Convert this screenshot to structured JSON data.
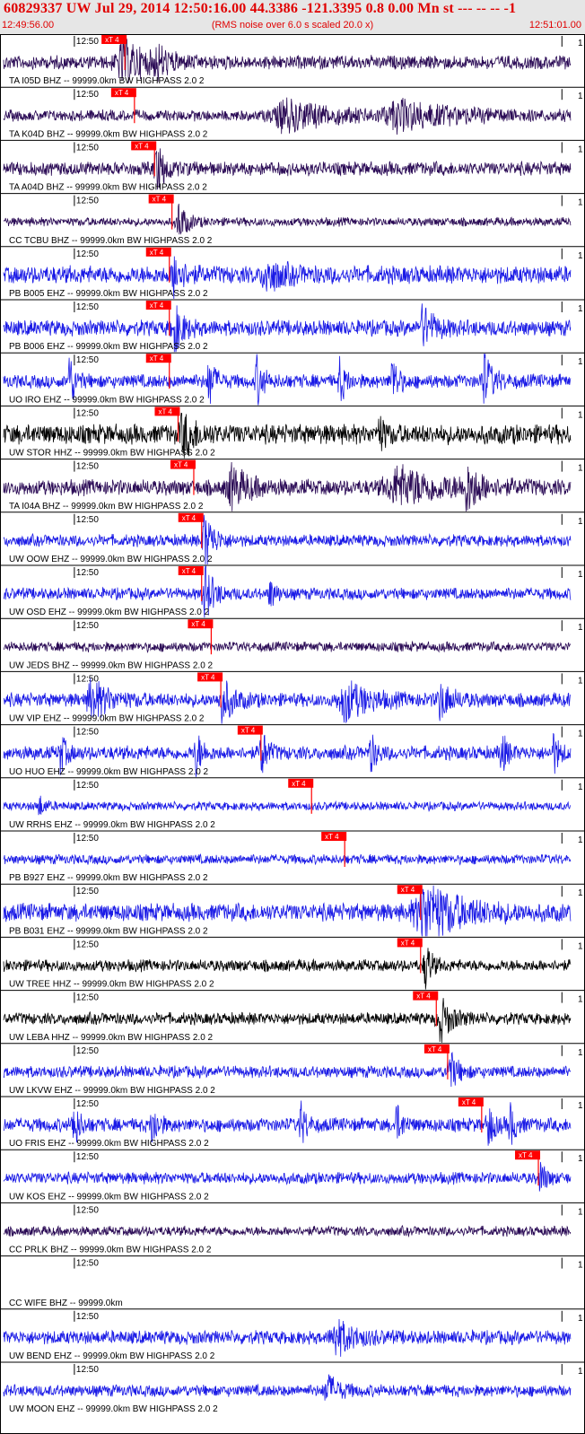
{
  "header": {
    "title": "60829337 UW Jul 29, 2014 12:50:16.00    44.3386 -121.3395  0.8 0.00 Mn st --- -- --   -1",
    "start_time": "12:49:56.00",
    "subtitle": "(RMS noise over 6.0 s scaled 20.0 x)",
    "end_time": "12:51:01.00"
  },
  "chart_data": {
    "type": "line",
    "title": "60829337 UW Jul 29, 2014 12:50:16.00    44.3386 -121.3395  0.8 0.00 Mn st --- -- --   -1",
    "x_range": [
      "12:49:56.00",
      "12:51:01.00"
    ],
    "x_range_seconds": [
      0,
      65
    ],
    "tick_label": "12:50",
    "tick_seconds": [
      4,
      64
    ],
    "pick_label": "xT 4",
    "traces": [
      {
        "label": "TA I05D BHZ -- 99999.0km BW  HIGHPASS  2.0  2",
        "color": "#2a0a55",
        "pick_s": 13.9,
        "amp": 0.35,
        "bursts": [
          [
            13.5,
            4,
            1.0
          ],
          [
            17.5,
            2,
            0.6
          ]
        ]
      },
      {
        "label": "TA K04D BHZ -- 99999.0km BW  HIGHPASS  2.0  2",
        "color": "#2a0a55",
        "pick_s": 15.0,
        "amp": 0.28,
        "bursts": [
          [
            32,
            8,
            0.7
          ],
          [
            45,
            10,
            0.6
          ]
        ]
      },
      {
        "label": "TA A04D BHZ -- 99999.0km BW  HIGHPASS  2.0  2",
        "color": "#2a0a55",
        "pick_s": 17.3,
        "amp": 0.35,
        "bursts": [
          [
            17.5,
            1.5,
            1.1
          ]
        ]
      },
      {
        "label": "CC TCBU BHZ -- 99999.0km BW  HIGHPASS  2.0  2",
        "color": "#2a0a55",
        "pick_s": 19.3,
        "amp": 0.22,
        "bursts": [
          [
            20,
            1.5,
            0.9
          ]
        ]
      },
      {
        "label": "PB B005 EHZ -- 99999.0km BW  HIGHPASS  2.0  2",
        "color": "#1a1ae6",
        "pick_s": 19.0,
        "amp": 0.45,
        "bursts": [
          [
            19.5,
            1.5,
            1.0
          ],
          [
            30,
            3,
            0.7
          ]
        ]
      },
      {
        "label": "PB B006 EHZ -- 99999.0km BW  HIGHPASS  2.0  2",
        "color": "#1a1ae6",
        "pick_s": 19.0,
        "amp": 0.4,
        "bursts": [
          [
            19.5,
            1.5,
            1.1
          ],
          [
            48,
            2,
            0.9
          ]
        ]
      },
      {
        "label": "UO IRO EHZ -- 99999.0km BW  HIGHPASS  2.0  2",
        "color": "#1a1ae6",
        "pick_s": 19.0,
        "amp": 0.35,
        "bursts": [
          [
            7.5,
            1,
            1.3
          ],
          [
            23.5,
            1,
            1.2
          ],
          [
            29,
            1,
            1.3
          ],
          [
            38.5,
            1,
            1.0
          ],
          [
            44.5,
            1,
            1.2
          ],
          [
            55,
            1.5,
            1.3
          ]
        ]
      },
      {
        "label": "UW STOR HHZ -- 99999.0km BW  HIGHPASS  2.0  2",
        "color": "#000000",
        "pick_s": 20.0,
        "amp": 0.5,
        "bursts": [
          [
            20.5,
            2,
            1.0
          ],
          [
            43,
            1,
            0.8
          ]
        ]
      },
      {
        "label": "TA I04A BHZ -- 99999.0km BW  HIGHPASS  2.0  2",
        "color": "#2a0a55",
        "pick_s": 21.8,
        "amp": 0.4,
        "bursts": [
          [
            26,
            3,
            0.9
          ],
          [
            45,
            8,
            0.8
          ],
          [
            53,
            2,
            1.0
          ]
        ]
      },
      {
        "label": "UW OOW EHZ -- 99999.0km BW  HIGHPASS  2.0  2",
        "color": "#1a1ae6",
        "pick_s": 22.7,
        "amp": 0.3,
        "bursts": [
          [
            23,
            1.5,
            1.4
          ]
        ]
      },
      {
        "label": "UW OSD EHZ -- 99999.0km BW  HIGHPASS  2.0  2",
        "color": "#1a1ae6",
        "pick_s": 22.7,
        "amp": 0.3,
        "bursts": [
          [
            23,
            1.5,
            1.4
          ],
          [
            30.5,
            1,
            0.7
          ]
        ]
      },
      {
        "label": "UW JEDS BHZ -- 99999.0km BW  HIGHPASS  2.0  2",
        "color": "#2a0a55",
        "pick_s": 23.8,
        "amp": 0.25,
        "bursts": []
      },
      {
        "label": "UW VIP EHZ -- 99999.0km BW  HIGHPASS  2.0  2",
        "color": "#1a1ae6",
        "pick_s": 24.9,
        "amp": 0.35,
        "bursts": [
          [
            10,
            3,
            0.9
          ],
          [
            25,
            2,
            1.0
          ],
          [
            39,
            4,
            0.9
          ],
          [
            50,
            2,
            0.8
          ]
        ]
      },
      {
        "label": "UO HUO EHZ -- 99999.0km BW  HIGHPASS  2.0  2",
        "color": "#1a1ae6",
        "pick_s": 29.5,
        "amp": 0.35,
        "bursts": [
          [
            6.5,
            1,
            0.9
          ],
          [
            22,
            1,
            1.1
          ],
          [
            29.5,
            1,
            1.2
          ],
          [
            42,
            1,
            0.9
          ],
          [
            57,
            1,
            1.0
          ],
          [
            63,
            1,
            0.9
          ]
        ]
      },
      {
        "label": "UW RRHS EHZ -- 99999.0km BW  HIGHPASS  2.0  2",
        "color": "#1a1ae6",
        "pick_s": 35.3,
        "amp": 0.22,
        "bursts": [
          [
            4,
            1,
            0.5
          ]
        ]
      },
      {
        "label": "PB B927 EHZ -- 99999.0km BW  HIGHPASS  2.0  2",
        "color": "#1a1ae6",
        "pick_s": 39.1,
        "amp": 0.25,
        "bursts": []
      },
      {
        "label": "PB B031 EHZ -- 99999.0km BW  HIGHPASS  2.0  2",
        "color": "#1a1ae6",
        "pick_s": 47.8,
        "amp": 0.45,
        "bursts": [
          [
            48,
            6,
            1.4
          ]
        ]
      },
      {
        "label": "UW TREE HHZ -- 99999.0km BW  HIGHPASS  2.0  2",
        "color": "#000000",
        "pick_s": 47.8,
        "amp": 0.3,
        "bursts": [
          [
            48.3,
            1,
            1.3
          ]
        ]
      },
      {
        "label": "UW LEBA HHZ -- 99999.0km BW  HIGHPASS  2.0  2",
        "color": "#000000",
        "pick_s": 49.6,
        "amp": 0.3,
        "bursts": [
          [
            50,
            2,
            1.0
          ]
        ]
      },
      {
        "label": "UW LKVW EHZ -- 99999.0km BW  HIGHPASS  2.0  2",
        "color": "#1a1ae6",
        "pick_s": 50.9,
        "amp": 0.3,
        "bursts": [
          [
            51,
            1.5,
            1.0
          ]
        ]
      },
      {
        "label": "UO FRIS EHZ -- 99999.0km BW  HIGHPASS  2.0  2",
        "color": "#1a1ae6",
        "pick_s": 54.8,
        "amp": 0.35,
        "bursts": [
          [
            8,
            1,
            1.1
          ],
          [
            17,
            1,
            1.0
          ],
          [
            34,
            1,
            1.0
          ],
          [
            45,
            1,
            0.9
          ],
          [
            55.5,
            1,
            1.1
          ],
          [
            58,
            1,
            1.0
          ]
        ]
      },
      {
        "label": "UW KOS EHZ -- 99999.0km BW  HIGHPASS  2.0  2",
        "color": "#1a1ae6",
        "pick_s": 61.3,
        "amp": 0.3,
        "bursts": [
          [
            61.5,
            1,
            0.8
          ]
        ]
      },
      {
        "label": "CC PRLK BHZ -- 99999.0km BW  HIGHPASS  2.0  2",
        "color": "#2a0a55",
        "pick_s": null,
        "amp": 0.25,
        "bursts": []
      },
      {
        "label": "CC WIFE BHZ -- 99999.0km",
        "color": "#2a0a55",
        "pick_s": null,
        "amp": 0,
        "bursts": []
      },
      {
        "label": "UW BEND EHZ -- 99999.0km BW  HIGHPASS  2.0  2",
        "color": "#1a1ae6",
        "pick_s": null,
        "amp": 0.35,
        "bursts": [
          [
            38,
            3,
            0.8
          ]
        ]
      },
      {
        "label": "UW MOON EHZ -- 99999.0km BW  HIGHPASS  2.0  2",
        "color": "#1a1ae6",
        "pick_s": null,
        "amp": 0.3,
        "bursts": [
          [
            37,
            2,
            0.7
          ]
        ]
      }
    ]
  }
}
